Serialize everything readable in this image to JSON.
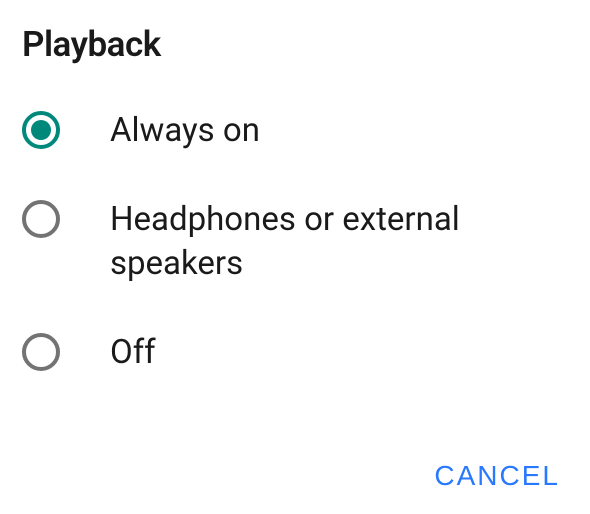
{
  "title": "Playback",
  "options": [
    {
      "label": "Always on",
      "selected": true
    },
    {
      "label": "Headphones or external speakers",
      "selected": false
    },
    {
      "label": "Off",
      "selected": false
    }
  ],
  "cancel_label": "CANCEL"
}
